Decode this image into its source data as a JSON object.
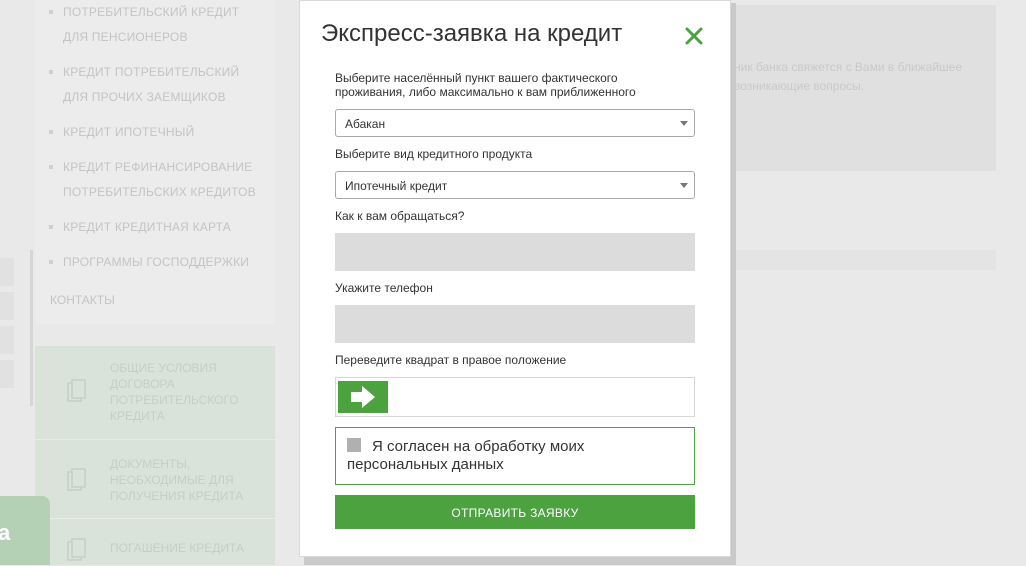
{
  "background": {
    "menu_items": [
      {
        "label": "Потребительский кредит для пенсионеров"
      },
      {
        "label": "Кредит потребительский для прочих заемщиков"
      },
      {
        "label": "Кредит ипотечный"
      },
      {
        "label": "Кредит рефинансирование потребительских кредитов"
      },
      {
        "label": "Кредит кредитная карта"
      },
      {
        "label": "Программы господдержки"
      }
    ],
    "contacts_label": "Контакты",
    "doc_links": [
      {
        "label": "Общие условия договора потребительского кредита",
        "icon": "documents-icon"
      },
      {
        "label": "Документы, необходимые для получения кредита",
        "icon": "documents-icon"
      },
      {
        "label": "Погашение кредита",
        "icon": "documents-icon"
      }
    ],
    "right_text": "ник банка свяжется с Вами в ближайшее возникающие вопросы.",
    "float_button_label": "а"
  },
  "modal": {
    "title": "Экспресс-заявка на кредит",
    "close_icon": "close-icon",
    "city_label": "Выберите населённый пункт вашего фактического проживания, либо максимально к вам приближенного",
    "city_value": "Абакан",
    "product_label": "Выберите вид кредитного продукта",
    "product_value": "Ипотечный кредит",
    "name_label": "Как к вам обращаться?",
    "name_value": "",
    "phone_label": "Укажите телефон",
    "phone_value": "",
    "slider_label": "Переведите квадрат в правое положение",
    "consent_text": "Я согласен на обработку моих персональных данных",
    "consent_checked": false,
    "submit_label": "Отправить заявку"
  },
  "colors": {
    "accent": "#4ba23f",
    "overlay_bg": "#e9e9e9"
  }
}
